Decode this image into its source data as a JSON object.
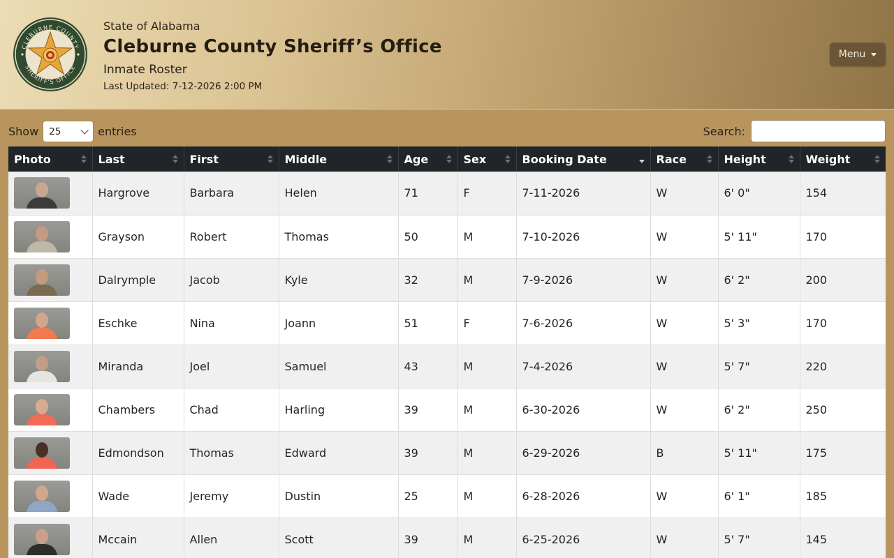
{
  "header": {
    "state": "State of Alabama",
    "office": "Cleburne County Sheriff’s Office",
    "subtitle": "Inmate Roster",
    "last_updated": "Last Updated: 7-12-2026 2:00 PM",
    "menu_label": "Menu",
    "seal_text_top": "CLEBURNE COUNTY",
    "seal_text_bottom": "SHERIFF'S OFFICE"
  },
  "controls": {
    "show_label": "Show",
    "page_length": "25",
    "entries_label": "entries",
    "search_label": "Search:",
    "search_value": ""
  },
  "table": {
    "columns": [
      "Photo",
      "Last",
      "First",
      "Middle",
      "Age",
      "Sex",
      "Booking Date",
      "Race",
      "Height",
      "Weight"
    ],
    "sorted_column": "Booking Date",
    "sort_direction": "descending",
    "rows": [
      {
        "last": "Hargrove",
        "first": "Barbara",
        "middle": "Helen",
        "age": "71",
        "sex": "F",
        "booking_date": "7-11-2026",
        "race": "W",
        "height": "6' 0\"",
        "weight": "154",
        "shirt": "#3d3b39",
        "skin": "#c9a892"
      },
      {
        "last": "Grayson",
        "first": "Robert",
        "middle": "Thomas",
        "age": "50",
        "sex": "M",
        "booking_date": "7-10-2026",
        "race": "W",
        "height": "5' 11\"",
        "weight": "170",
        "shirt": "#bfb7a8",
        "skin": "#c49a82"
      },
      {
        "last": "Dalrymple",
        "first": "Jacob",
        "middle": "Kyle",
        "age": "32",
        "sex": "M",
        "booking_date": "7-9-2026",
        "race": "W",
        "height": "6' 2\"",
        "weight": "200",
        "shirt": "#7a6a4e",
        "skin": "#c59b80"
      },
      {
        "last": "Eschke",
        "first": "Nina",
        "middle": "Joann",
        "age": "51",
        "sex": "F",
        "booking_date": "7-6-2026",
        "race": "W",
        "height": "5' 3\"",
        "weight": "170",
        "shirt": "#f27a4f",
        "skin": "#d2a68c"
      },
      {
        "last": "Miranda",
        "first": "Joel",
        "middle": "Samuel",
        "age": "43",
        "sex": "M",
        "booking_date": "7-4-2026",
        "race": "W",
        "height": "5' 7\"",
        "weight": "220",
        "shirt": "#e6e4e0",
        "skin": "#c39e86"
      },
      {
        "last": "Chambers",
        "first": "Chad",
        "middle": "Harling",
        "age": "39",
        "sex": "M",
        "booking_date": "6-30-2026",
        "race": "W",
        "height": "6' 2\"",
        "weight": "250",
        "shirt": "#f36a55",
        "skin": "#d7ab90"
      },
      {
        "last": "Edmondson",
        "first": "Thomas",
        "middle": "Edward",
        "age": "39",
        "sex": "M",
        "booking_date": "6-29-2026",
        "race": "B",
        "height": "5' 11\"",
        "weight": "175",
        "shirt": "#f06452",
        "skin": "#4a3024"
      },
      {
        "last": "Wade",
        "first": "Jeremy",
        "middle": "Dustin",
        "age": "25",
        "sex": "M",
        "booking_date": "6-28-2026",
        "race": "W",
        "height": "6' 1\"",
        "weight": "185",
        "shirt": "#8fa6c4",
        "skin": "#d0a78e"
      },
      {
        "last": "Mccain",
        "first": "Allen",
        "middle": "Scott",
        "age": "39",
        "sex": "M",
        "booking_date": "6-25-2026",
        "race": "W",
        "height": "5' 7\"",
        "weight": "145",
        "shirt": "#2f2d2b",
        "skin": "#c8a08a"
      }
    ]
  },
  "colors": {
    "header_dark": "#212529",
    "page_bg": "#b8955e",
    "menu_bg": "#6a5637",
    "seal_green": "#2f4a2f",
    "star_gold": "#e7a63c"
  }
}
